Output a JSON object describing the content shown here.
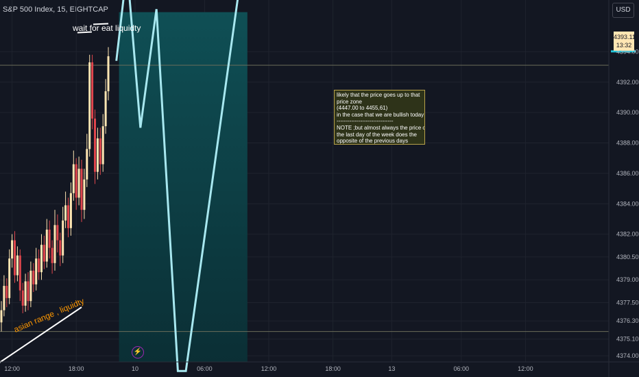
{
  "header": {
    "symbol": "S&P 500 Index, 15, EIGHTCAP"
  },
  "currency_button": {
    "label": "USD"
  },
  "price_label": {
    "price": "4393.11",
    "countdown": "13:32"
  },
  "annotations": {
    "wait_text": "wait for eat liquidty",
    "asian_text": "asian range , liquidty",
    "note_lines": [
      "likely that the price goes up to that",
      "price zone",
      "(4447.00 to 4455,61)",
      "in the case that we are bullish today",
      "-------------------------------",
      "NOTE ;but almost always the price on",
      "the last day of the week does the",
      "opposite of the previous days"
    ]
  },
  "icons": {
    "event": "lightning-icon"
  },
  "colors": {
    "bull": "#ffe6b3",
    "bear": "#e0454c",
    "projection": "#a8e8f0",
    "zone": "#0f4f55",
    "background": "#131722"
  },
  "chart_data": {
    "type": "candlestick",
    "title": "S&P 500 Index, 15, EIGHTCAP",
    "ylim": [
      4373.6,
      4397.4
    ],
    "y_ticks": [
      "4374.00",
      "4375.10",
      "4376.30",
      "4377.50",
      "4379.00",
      "4380.50",
      "4382.00",
      "4384.00",
      "4386.00",
      "4388.00",
      "4390.00",
      "4392.00",
      "4394.00"
    ],
    "x_ticks": [
      {
        "label": "06:00",
        "slot": -20
      },
      {
        "label": "12:00",
        "slot": 4
      },
      {
        "label": "18:00",
        "slot": 28
      },
      {
        "label": "10",
        "slot": 50
      },
      {
        "label": "06:00",
        "slot": 76
      },
      {
        "label": "12:00",
        "slot": 100
      },
      {
        "label": "18:00",
        "slot": 124
      },
      {
        "label": "13",
        "slot": 146
      },
      {
        "label": "06:00",
        "slot": 172
      },
      {
        "label": "12:00",
        "slot": 196
      }
    ],
    "candles": [
      {
        "o": 4376.2,
        "c": 4377.0,
        "h": 4377.6,
        "l": 4375.6
      },
      {
        "o": 4377.0,
        "c": 4378.6,
        "h": 4379.3,
        "l": 4376.6
      },
      {
        "o": 4378.6,
        "c": 4377.8,
        "h": 4379.1,
        "l": 4377.2
      },
      {
        "o": 4377.8,
        "c": 4380.4,
        "h": 4381.0,
        "l": 4377.4
      },
      {
        "o": 4380.4,
        "c": 4381.6,
        "h": 4382.0,
        "l": 4379.8
      },
      {
        "o": 4381.6,
        "c": 4379.3,
        "h": 4382.2,
        "l": 4378.8
      },
      {
        "o": 4379.3,
        "c": 4380.6,
        "h": 4381.2,
        "l": 4378.9
      },
      {
        "o": 4380.6,
        "c": 4378.3,
        "h": 4381.0,
        "l": 4377.6
      },
      {
        "o": 4378.3,
        "c": 4377.3,
        "h": 4378.8,
        "l": 4376.8
      },
      {
        "o": 4377.3,
        "c": 4378.9,
        "h": 4379.4,
        "l": 4376.9
      },
      {
        "o": 4378.9,
        "c": 4377.6,
        "h": 4379.5,
        "l": 4377.0
      },
      {
        "o": 4377.6,
        "c": 4379.6,
        "h": 4380.2,
        "l": 4377.2
      },
      {
        "o": 4379.6,
        "c": 4378.7,
        "h": 4380.1,
        "l": 4378.2
      },
      {
        "o": 4378.7,
        "c": 4380.4,
        "h": 4381.1,
        "l": 4378.3
      },
      {
        "o": 4380.4,
        "c": 4379.5,
        "h": 4381.0,
        "l": 4379.0
      },
      {
        "o": 4379.5,
        "c": 4381.3,
        "h": 4382.0,
        "l": 4379.0
      },
      {
        "o": 4381.3,
        "c": 4380.2,
        "h": 4381.9,
        "l": 4379.7
      },
      {
        "o": 4380.2,
        "c": 4382.3,
        "h": 4383.0,
        "l": 4379.8
      },
      {
        "o": 4382.3,
        "c": 4381.1,
        "h": 4382.9,
        "l": 4380.4
      },
      {
        "o": 4381.1,
        "c": 4380.1,
        "h": 4381.6,
        "l": 4379.4
      },
      {
        "o": 4380.1,
        "c": 4382.6,
        "h": 4383.6,
        "l": 4379.6
      },
      {
        "o": 4382.6,
        "c": 4381.6,
        "h": 4383.3,
        "l": 4380.8
      },
      {
        "o": 4381.6,
        "c": 4380.6,
        "h": 4382.1,
        "l": 4379.9
      },
      {
        "o": 4380.6,
        "c": 4382.9,
        "h": 4383.8,
        "l": 4380.1
      },
      {
        "o": 4382.9,
        "c": 4383.9,
        "h": 4384.8,
        "l": 4382.4
      },
      {
        "o": 4383.9,
        "c": 4382.4,
        "h": 4384.4,
        "l": 4381.8
      },
      {
        "o": 4382.4,
        "c": 4384.7,
        "h": 4385.4,
        "l": 4381.9
      },
      {
        "o": 4384.7,
        "c": 4386.6,
        "h": 4387.5,
        "l": 4384.2
      },
      {
        "o": 4386.6,
        "c": 4384.4,
        "h": 4387.0,
        "l": 4383.6
      },
      {
        "o": 4384.4,
        "c": 4386.3,
        "h": 4387.1,
        "l": 4383.9
      },
      {
        "o": 4386.3,
        "c": 4383.6,
        "h": 4386.9,
        "l": 4382.8
      },
      {
        "o": 4383.6,
        "c": 4385.6,
        "h": 4386.3,
        "l": 4383.0
      },
      {
        "o": 4385.6,
        "c": 4387.6,
        "h": 4388.6,
        "l": 4385.1
      },
      {
        "o": 4387.6,
        "c": 4393.3,
        "h": 4393.8,
        "l": 4387.1
      },
      {
        "o": 4393.3,
        "c": 4389.6,
        "h": 4393.8,
        "l": 4388.9
      },
      {
        "o": 4389.6,
        "c": 4386.1,
        "h": 4390.2,
        "l": 4385.3
      },
      {
        "o": 4386.1,
        "c": 4388.3,
        "h": 4389.0,
        "l": 4385.6
      },
      {
        "o": 4388.3,
        "c": 4386.6,
        "h": 4389.0,
        "l": 4385.9
      },
      {
        "o": 4386.6,
        "c": 4389.1,
        "h": 4389.9,
        "l": 4386.1
      },
      {
        "o": 4389.1,
        "c": 4391.4,
        "h": 4392.2,
        "l": 4388.6
      },
      {
        "o": 4391.4,
        "c": 4393.7,
        "h": 4394.3,
        "l": 4390.8
      }
    ],
    "projection_path": [
      {
        "slot": 43,
        "price": 4393.4
      },
      {
        "slot": 47,
        "price": 4399.5
      },
      {
        "slot": 52,
        "price": 4389.0
      },
      {
        "slot": 58,
        "price": 4396.8
      },
      {
        "slot": 66,
        "price": 4373.0
      },
      {
        "slot": 69,
        "price": 4373.0
      },
      {
        "slot": 90,
        "price": 4399.5
      }
    ],
    "price_zone": {
      "slot_start": 44,
      "slot_end": 92,
      "price_high": 4396.6,
      "price_low": 4373.6
    },
    "liquidity_line": {
      "price": 4375.6
    },
    "current_price_line": {
      "price": 4393.11
    },
    "asian_range_line": [
      {
        "slot": -2,
        "price": 4373.4
      },
      {
        "slot": 30,
        "price": 4377.2
      }
    ],
    "wait_line": [
      {
        "slot": 11,
        "price": 4395.3
      },
      {
        "slot": 40,
        "price": 4395.8
      }
    ]
  }
}
